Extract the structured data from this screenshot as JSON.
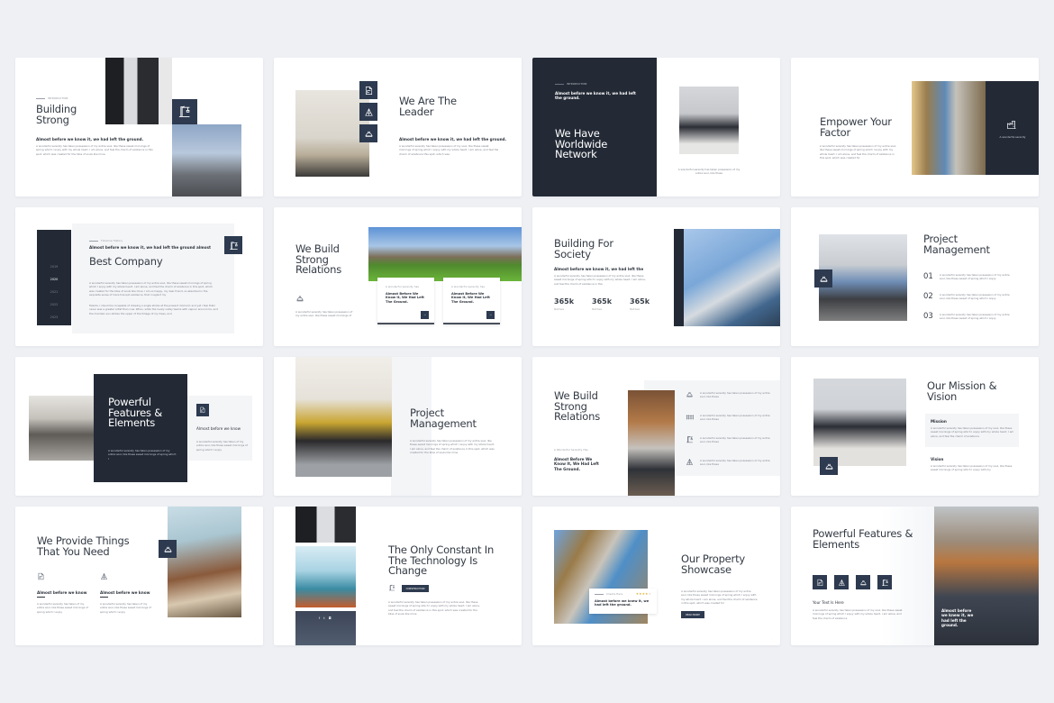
{
  "colors": {
    "navy": "#232a36",
    "icon_bg": "#2d3a4f",
    "background": "#eef0f4",
    "panel": "#f4f5f7"
  },
  "slides": [
    {
      "id": 1,
      "label": "INTRODUCTION",
      "title": "Building Strong",
      "subtitle": "Almost before we know it, we had left the ground.",
      "body": "A wonderful serenity has taken possession of my entire soul, like these sweet mornings of spring which I enjoy with my whole heart. I am alone, and feel the charm of existence in this spot, which was created for the bliss of souls like mine.",
      "icon": "crane-icon"
    },
    {
      "id": 2,
      "title": "We Are The Leader",
      "subtitle": "Almost before we know it, we had left the ground.",
      "body": "A wonderful serenity has taken possession of my soul, like these sweet mornings of spring which I enjoy with my whole heart. I am alone, and feel the charm of existence this spot, which was",
      "icons": [
        "blueprint-icon",
        "drafting-icon",
        "helmet-icon"
      ]
    },
    {
      "id": 3,
      "label": "INTRODUCTION",
      "subtitle": "Almost before we know it, we had left the ground.",
      "title": "We Have Worldwide Network",
      "caption": "A wonderful serenity has taken possession of my entire soul, like these"
    },
    {
      "id": 4,
      "title": "Empower Your Factor",
      "body": "A wonderful serenity has taken possession of my entire soul, like these sweet mornings of spring which I enjoy with my whole heart. I am alone, and feel the charm of existence in this spot, which was created for",
      "panel_caption": "A wonderful serenity",
      "icon": "factory-icon"
    },
    {
      "id": 5,
      "label": "Timeline History",
      "subtitle": "Almost before we know it, we had left the ground almost",
      "title": "Best Company",
      "body": "A wonderful serenity has taken possession of my entire soul, like these sweet mornings of spring which I enjoy with my whole heart. I am alone, and feel the charm of existence in this spot, which was created for the bliss of souls like mine. I am so happy, my dear friend, so absorbed in the exquisite sense of mere tranquil existence, that I neglect my",
      "body2": "Talents. I should be incapable of drawing a single stroke at the present moment; and yet I feel that I never was a greater artist than now. When, while the lovely valley teems with vapour around me, and the meridian sun strikes the upper of the foliage of my trees, and",
      "years": [
        "2019",
        "2020",
        "2021",
        "2022",
        "2023"
      ],
      "active_year": "2020",
      "icon": "crane-icon"
    },
    {
      "id": 6,
      "title": "We Build Strong Relations",
      "body": "A wonderful serenity has taken possession of my entire soul, like these sweet mornings of",
      "icon": "helmet-icon",
      "cards": [
        {
          "label": "A wonderful serenity has",
          "title": "Almost Before We Know It, We Had Left The Ground."
        },
        {
          "label": "A wonderful serenity has",
          "title": "Almost Before We Know It, We Had Left The Ground."
        }
      ]
    },
    {
      "id": 7,
      "title": "Building For Society",
      "subtitle": "Almost before we know it, we had left the",
      "body": "A wonderful serenity has taken possession of my entire soul, like these sweet mornings of spring which I enjoy with my whole heart. I am alone, and feel the charm of existence in this",
      "stats": [
        {
          "value": "365k",
          "label": "Text here"
        },
        {
          "value": "365k",
          "label": "Text here"
        },
        {
          "value": "365k",
          "label": "Text here"
        }
      ]
    },
    {
      "id": 8,
      "title": "Project Management",
      "items": [
        {
          "num": "01",
          "text": "A wonderful serenity has taken possession of my entire soul, like these sweet of spring which I enjoy"
        },
        {
          "num": "02",
          "text": "A wonderful serenity has taken possession of my entire soul, like these sweet of spring which I enjoy"
        },
        {
          "num": "03",
          "text": "A wonderful serenity has taken possession of my entire soul, like these sweet of spring which I enjoy"
        }
      ],
      "icon": "helmet-icon"
    },
    {
      "id": 9,
      "title": "Powerful Features & Elements",
      "body": "A wonderful serenity has taken possession of my entire soul, like these sweet mornings of spring which I",
      "side_title": "Almost before we know",
      "side_body": "A wonderful serenity has taken of my entire soul, like these sweet mornings of spring which I enjoy",
      "icon": "blueprint-icon"
    },
    {
      "id": 10,
      "title": "Project Management",
      "body": "A wonderful serenity has taken possession of my entire soul, like these sweet mornings of spring which I enjoy with my whole heart. I am alone, and feel the charm of existence in this spot, which was created for the bliss of souls like mine"
    },
    {
      "id": 11,
      "title": "We Build Strong Relations",
      "label": "A Wonderful Serenity Has",
      "subtitle": "Almost Before We Know It, We Had Left The Ground.",
      "items": [
        {
          "icon": "helmet-icon",
          "text": "A wonderful serenity has taken possession of my entire soul, like these"
        },
        {
          "icon": "fence-icon",
          "text": "A wonderful serenity has taken possession of my entire soul, like these"
        },
        {
          "icon": "crane-icon",
          "text": "A wonderful serenity has taken possession of my entire soul, like these"
        },
        {
          "icon": "drafting-icon",
          "text": "A wonderful serenity has taken possession of my entire soul, like these"
        }
      ]
    },
    {
      "id": 12,
      "title": "Our Mission & Vision",
      "mission_title": "Mission",
      "mission_body": "A wonderful serenity has taken possession of my soul, like these sweet mornings of spring which I enjoy with my whole heart. I am alone, and feel the charm of existence",
      "vision_title": "Vision",
      "vision_body": "A wonderful serenity has taken possession of my soul, like these sweet mornings of spring which I enjoy with my",
      "icon": "helmet-icon"
    },
    {
      "id": 13,
      "title": "We Provide Things That You Need",
      "features": [
        {
          "icon": "blueprint-icon",
          "title": "Almost before we know",
          "body": "A wonderful serenity has taken of my entire soul, like these sweet mornings of spring which I enjoy"
        },
        {
          "icon": "drafting-icon",
          "title": "Almost before we know",
          "body": "A wonderful serenity has taken of my entire soul, like these sweet mornings of spring which I enjoy"
        }
      ],
      "icon": "helmet-icon"
    },
    {
      "id": 14,
      "title": "The Only Constant In The Technology Is Change",
      "button": "CONSTRUCTION",
      "body": "A wonderful serenity has taken possession of my entire soul, like these sweet mornings of spring which I enjoy with my whole heart. I am alone, and feel the charm of existence in this spot, which was created for the bliss of souls like mine",
      "social": [
        "facebook-icon",
        "twitter-icon",
        "instagram-icon"
      ],
      "icon": "crane-icon"
    },
    {
      "id": 15,
      "title": "Our Property Showcase",
      "review_label": "Clients Here",
      "rating": 4,
      "rating_max": 5,
      "review_text": "Almost before we knew it, we had left the ground.",
      "body": "A wonderful serenity has taken possession of my entire soul, like these sweet mornings of spring which I enjoy with my whole heart. I am alone, and feel the charm of existence in this spot, which was created for",
      "button": "READ MORE"
    },
    {
      "id": 16,
      "title": "Powerful Features & Elements",
      "subtitle": "Your Text Is Here",
      "body": "A wonderful serenity has taken possession of my soul, like these sweet mornings of spring which I enjoy with my whole heart. I am alone, and feel the charm of existence",
      "overlay_text": "Almost before we knew it, we had left the ground.",
      "icons": [
        "blueprint-icon",
        "drafting-icon",
        "helmet-icon",
        "crane-icon"
      ]
    }
  ]
}
